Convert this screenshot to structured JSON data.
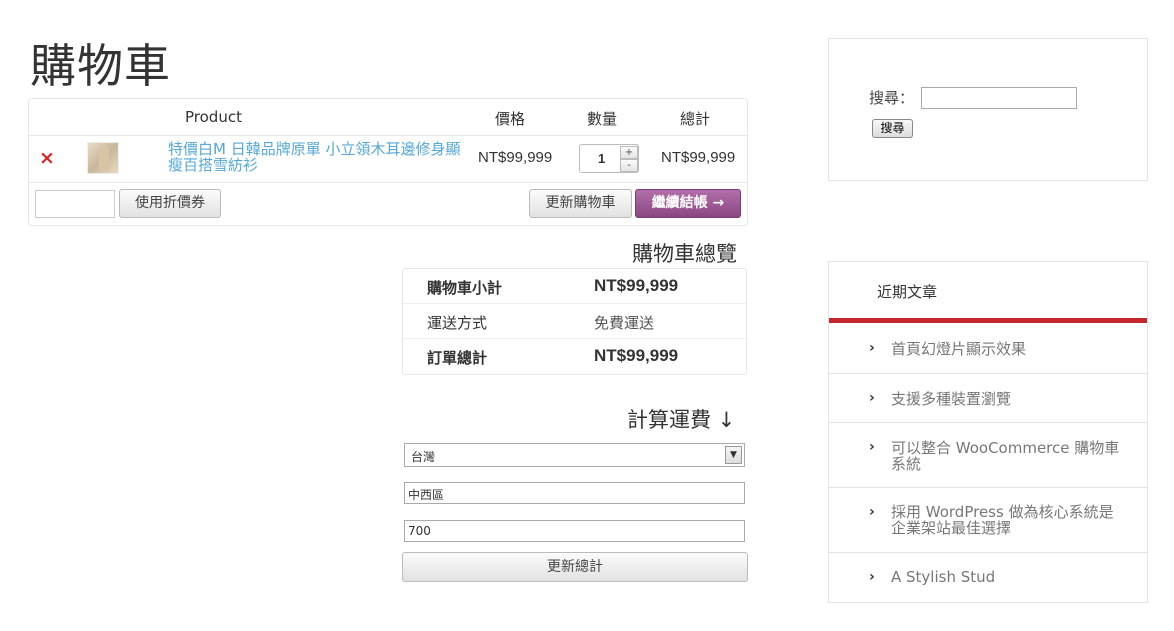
{
  "page": {
    "title": "購物車"
  },
  "cart": {
    "headers": {
      "product": "Product",
      "price": "價格",
      "quantity": "數量",
      "total": "總計"
    },
    "item": {
      "remove_icon": "×",
      "name": "特價白M 日韓品牌原單 小立領木耳邊修身顯瘦百搭雪紡衫",
      "price": "NT$99,999",
      "quantity": "1",
      "total": "NT$99,999"
    },
    "coupon": {
      "value": "",
      "apply_label": "使用折價券"
    },
    "update_label": "更新購物車",
    "checkout_label": "繼續結帳 →"
  },
  "totals": {
    "title": "購物車總覽",
    "rows": [
      {
        "label": "購物車小計",
        "value": "NT$99,999"
      },
      {
        "label": "運送方式",
        "value": "免費運送"
      },
      {
        "label": "訂單總計",
        "value": "NT$99,999"
      }
    ]
  },
  "shipping": {
    "title": "計算運費 ↓",
    "country": "台灣",
    "city": "中西區",
    "postcode": "700",
    "update_label": "更新總計"
  },
  "sidebar": {
    "search": {
      "label": "搜尋：",
      "button": "搜尋",
      "value": ""
    },
    "recent": {
      "title": "近期文章",
      "posts": [
        "首頁幻燈片顯示效果",
        "支援多種裝置瀏覽",
        "可以整合 WooCommerce 購物車系統",
        "採用 WordPress 做為核心系統是企業架站最佳選擇",
        "A Stylish Stud"
      ]
    }
  },
  "colors": {
    "link": "#55a8d8",
    "checkout": "#9a5592",
    "accent_bar": "#c1272d",
    "remove": "#dd2222"
  }
}
